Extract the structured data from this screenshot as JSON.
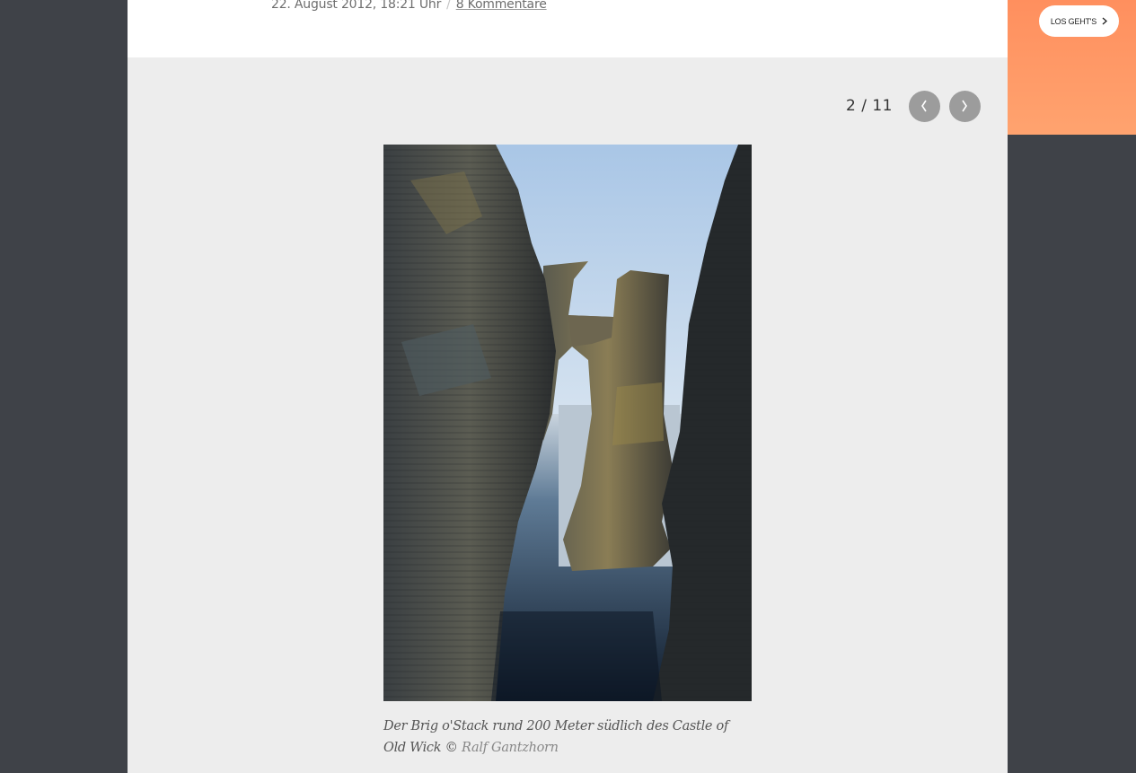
{
  "article": {
    "date": "22. August 2012, 18:21 Uhr",
    "separator": "/",
    "comments_link": "8 Kommentare"
  },
  "gallery": {
    "counter": "2 / 11",
    "prev_icon": "chevron-left-icon",
    "next_icon": "chevron-right-icon",
    "caption_text": "Der Brig o'Stack rund 200 Meter südlich des Castle of Old Wick © ",
    "caption_credit": "Ralf Gantzhorn"
  },
  "promo": {
    "button_label": "LOS GEHT'S",
    "button_icon": "chevron-right-icon",
    "color": "#ff9565"
  },
  "colors": {
    "background": "#3f4248",
    "gallery_bg": "#ededed",
    "pager_button": "#9c9c9c"
  }
}
